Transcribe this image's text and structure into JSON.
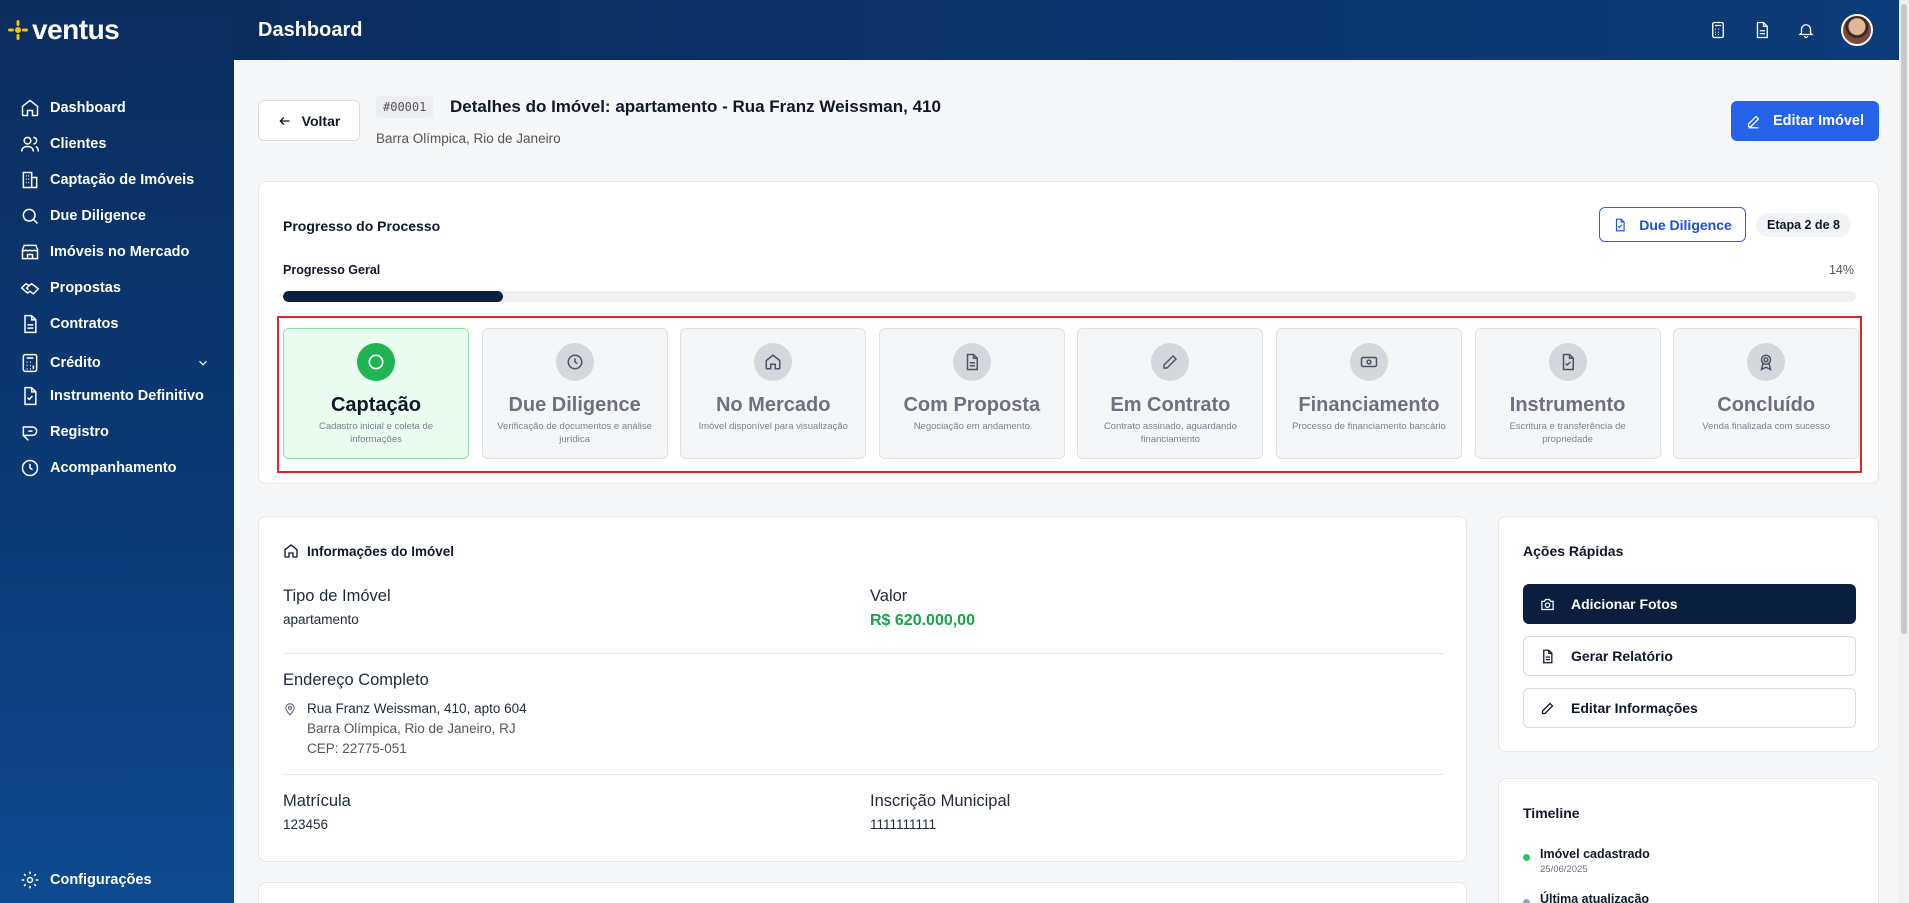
{
  "app": {
    "logo_text": "ventus",
    "page_title": "Dashboard"
  },
  "colors": {
    "primary": "#2563eb",
    "sidebar": "#0b3a75",
    "success": "#16a34a",
    "dark": "#0a1f3f",
    "highlight": "#d62828"
  },
  "sidebar": {
    "items": [
      {
        "label": "Dashboard",
        "icon": "home-icon"
      },
      {
        "label": "Clientes",
        "icon": "users-icon"
      },
      {
        "label": "Captação de Imóveis",
        "icon": "building-icon"
      },
      {
        "label": "Due Diligence",
        "icon": "search-icon"
      },
      {
        "label": "Imóveis no Mercado",
        "icon": "store-icon"
      },
      {
        "label": "Propostas",
        "icon": "handshake-icon"
      },
      {
        "label": "Contratos",
        "icon": "file-icon"
      },
      {
        "label": "Crédito",
        "icon": "calculator-icon"
      },
      {
        "label": "Instrumento Definitivo",
        "icon": "file-check-icon"
      },
      {
        "label": "Registro",
        "icon": "registry-icon"
      },
      {
        "label": "Acompanhamento",
        "icon": "clock-icon"
      }
    ],
    "settings_label": "Configurações"
  },
  "header": {
    "back_label": "Voltar",
    "code": "#00001",
    "title": "Detalhes do Imóvel: apartamento - Rua Franz Weissman, 410",
    "subtitle": "Barra Olímpica, Rio de Janeiro",
    "edit_label": "Editar Imóvel"
  },
  "progress": {
    "title": "Progresso do Processo",
    "current_stage_label": "Due Diligence",
    "step_badge": "Etapa 2 de 8",
    "overall_label": "Progresso Geral",
    "percent_text": "14%",
    "percent": 14,
    "stages": [
      {
        "name": "Captação",
        "desc": "Cadastro inicial e coleta de informações",
        "icon": "circle-icon",
        "active": true
      },
      {
        "name": "Due Diligence",
        "desc": "Verificação de documentos e análise jurídica",
        "icon": "clock-icon",
        "active": false
      },
      {
        "name": "No Mercado",
        "desc": "Imóvel disponível para visualização",
        "icon": "home-icon",
        "active": false
      },
      {
        "name": "Com Proposta",
        "desc": "Negociação em andamento",
        "icon": "document-icon",
        "active": false
      },
      {
        "name": "Em Contrato",
        "desc": "Contrato assinado, aguardando financiamento",
        "icon": "pencil-icon",
        "active": false
      },
      {
        "name": "Financiamento",
        "desc": "Processo de financiamento bancário",
        "icon": "banknote-icon",
        "active": false
      },
      {
        "name": "Instrumento",
        "desc": "Escritura e transferência de propriedade",
        "icon": "file-check-icon",
        "active": false
      },
      {
        "name": "Concluído",
        "desc": "Venda finalizada com sucesso",
        "icon": "award-icon",
        "active": false
      }
    ]
  },
  "info": {
    "title": "Informações do Imóvel",
    "tipo_label": "Tipo de Imóvel",
    "tipo_value": "apartamento",
    "valor_label": "Valor",
    "valor_value": "R$ 620.000,00",
    "endereco_label": "Endereço Completo",
    "endereco_line1": "Rua Franz Weissman, 410, apto 604",
    "endereco_line2": "Barra Olímpica, Rio de Janeiro, RJ",
    "endereco_line3": "CEP: 22775-051",
    "matricula_label": "Matrícula",
    "matricula_value": "123456",
    "inscricao_label": "Inscrição Municipal",
    "inscricao_value": "1111111111"
  },
  "quick_actions": {
    "title": "Ações Rápidas",
    "add_photos": "Adicionar Fotos",
    "report": "Gerar Relatório",
    "edit_info": "Editar Informações"
  },
  "timeline": {
    "title": "Timeline",
    "items": [
      {
        "name": "Imóvel cadastrado",
        "date": "25/06/2025"
      },
      {
        "name": "Última atualização",
        "date": ""
      }
    ]
  }
}
